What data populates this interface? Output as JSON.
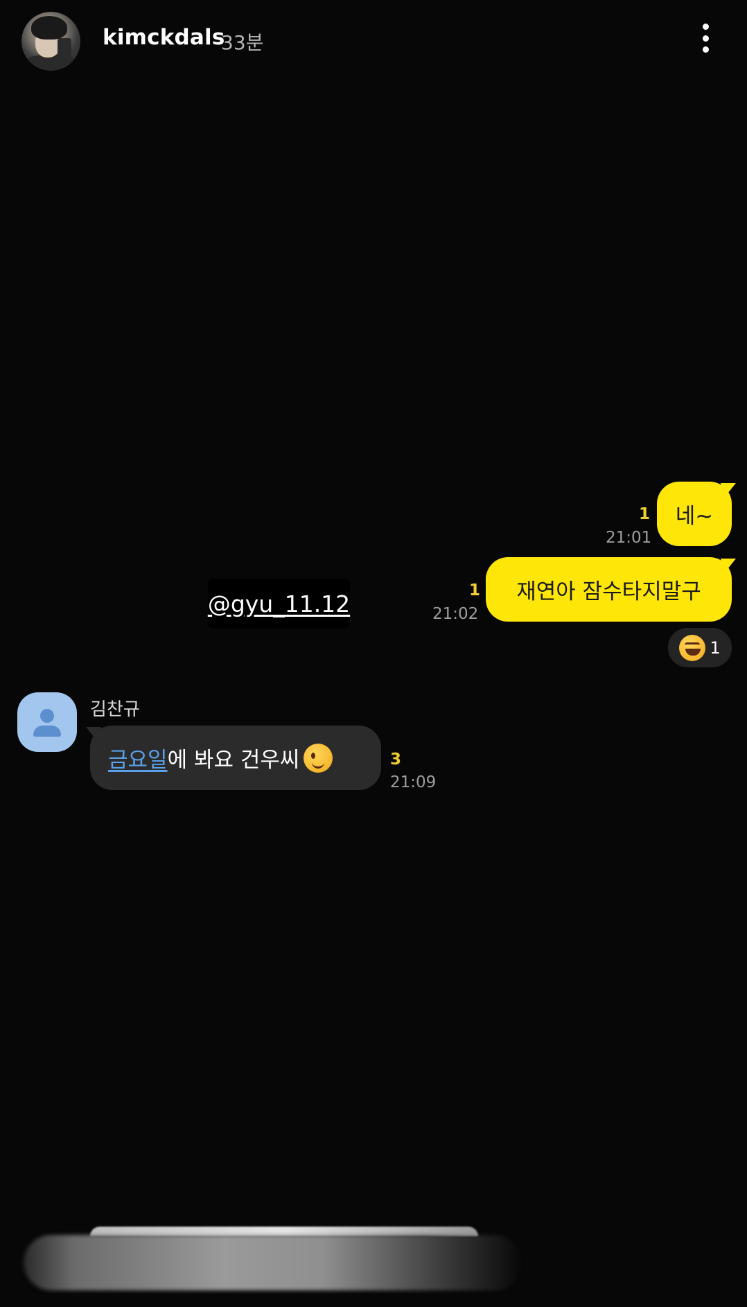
{
  "header": {
    "username": "kimckdals",
    "time_ago": "33분"
  },
  "sticker": {
    "mention": "@gyu_11.12"
  },
  "messages": {
    "sent": [
      {
        "text": "네~",
        "unread": "1",
        "time": "21:01"
      },
      {
        "text": "재연아 잠수타지말구",
        "unread": "1",
        "time": "21:02",
        "reaction_count": "1"
      }
    ],
    "received": {
      "sender": "김찬규",
      "link_text": "금요일",
      "text": "에 봐요 건우씨",
      "unread": "3",
      "time": "21:09"
    }
  },
  "colors": {
    "background": "#070707",
    "sent_bubble": "#fde608",
    "received_bubble": "#2b2b2b",
    "unread": "#f1cf2e",
    "link": "#5aa0e8"
  },
  "icons": {
    "more": "more-vertical-icon",
    "reaction": "laughing-emoji-icon",
    "wink": "winking-emoji-icon",
    "default_avatar": "person-icon"
  }
}
